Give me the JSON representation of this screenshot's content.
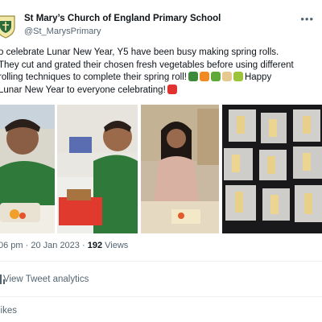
{
  "header": {
    "name": "St Mary’s Church of England Primary School",
    "handle": "@St_MarysPrimary",
    "more_icon": "more-horizontal-icon"
  },
  "tweet": {
    "lines": [
      "o celebrate Lunar New Year, Y5 have been busy making spring rolls.",
      "They cut and grated their chosen fresh vegetables before using different",
      "rolling techniques to complete their spring roll!",
      "Happy",
      "Lunar New Year to everyone celebrating!"
    ],
    "emojis": [
      "broccoli-emoji",
      "carrot-emoji",
      "leafy-greens-emoji",
      "onion-emoji",
      "sprout-emoji"
    ],
    "red_envelope_emoji": "red-envelope-emoji"
  },
  "photos": [
    {
      "alt": "boy in green jumper grating vegetables"
    },
    {
      "alt": "boy cutting vegetables on red board"
    },
    {
      "alt": "girl rolling spring roll at table"
    },
    {
      "alt": "spring rolls on rice paper sheets on dark tray"
    }
  ],
  "meta": {
    "time": "06 pm",
    "date": "20 Jan 2023",
    "views_count": "192",
    "views_label": "Views"
  },
  "analytics": {
    "label": "View Tweet analytics",
    "icon": "bar-chart-icon"
  },
  "likes_label": "likes",
  "colors": {
    "text": "#0f1419",
    "muted": "#536471",
    "divider": "#eff3f4"
  }
}
